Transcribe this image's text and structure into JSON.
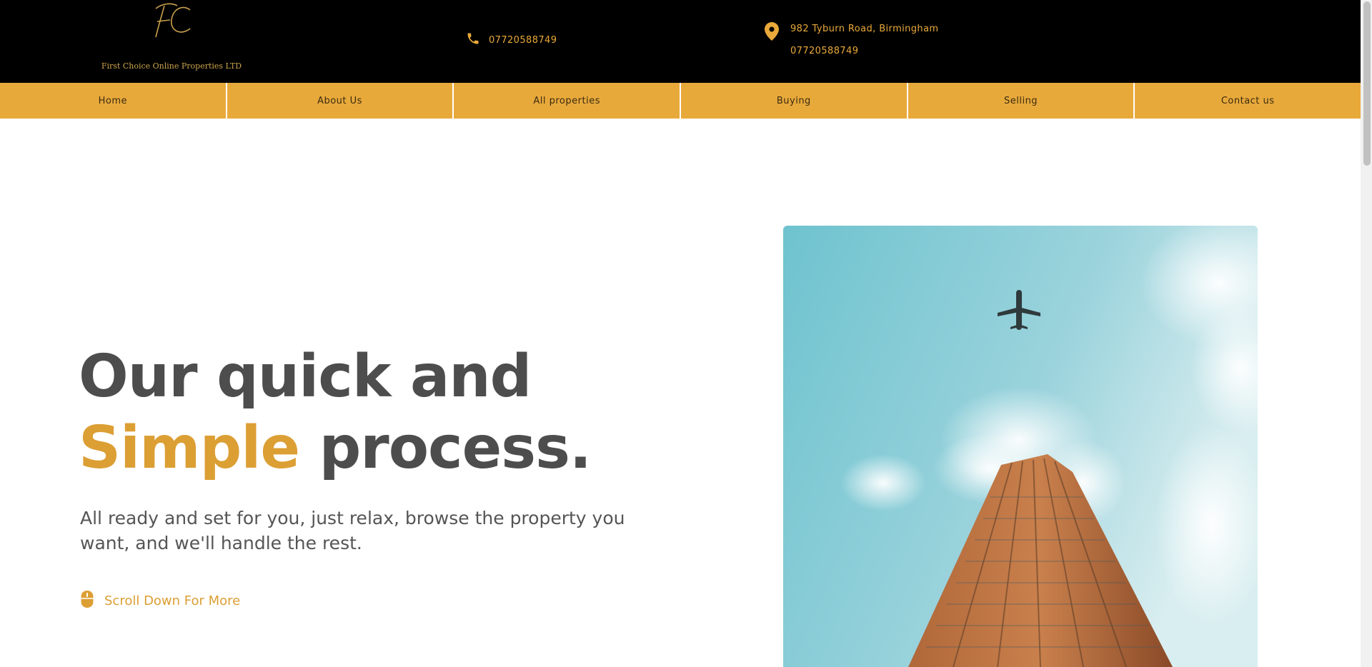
{
  "header": {
    "logo_monogram": "FC",
    "logo_text": "First Choice Online Properties LTD",
    "phone": "07720588749",
    "address": "982 Tyburn Road, Birmingham",
    "address_phone": "07720588749",
    "accent_color": "#e9a93a"
  },
  "nav": {
    "items": [
      {
        "label": "Home"
      },
      {
        "label": "About Us"
      },
      {
        "label": "All properties"
      },
      {
        "label": "Buying"
      },
      {
        "label": "Selling"
      },
      {
        "label": "Contact us"
      }
    ],
    "background": "#e8a93b"
  },
  "hero": {
    "title_line1": "Our quick and",
    "title_accent": "Simple",
    "title_rest": " process.",
    "subtitle": "All ready and set for you, just relax, browse the property you want, and we'll handle the rest.",
    "scroll_label": "Scroll Down For More"
  },
  "icons": {
    "phone": "phone-icon",
    "location": "location-pin-icon",
    "mouse": "mouse-icon"
  }
}
